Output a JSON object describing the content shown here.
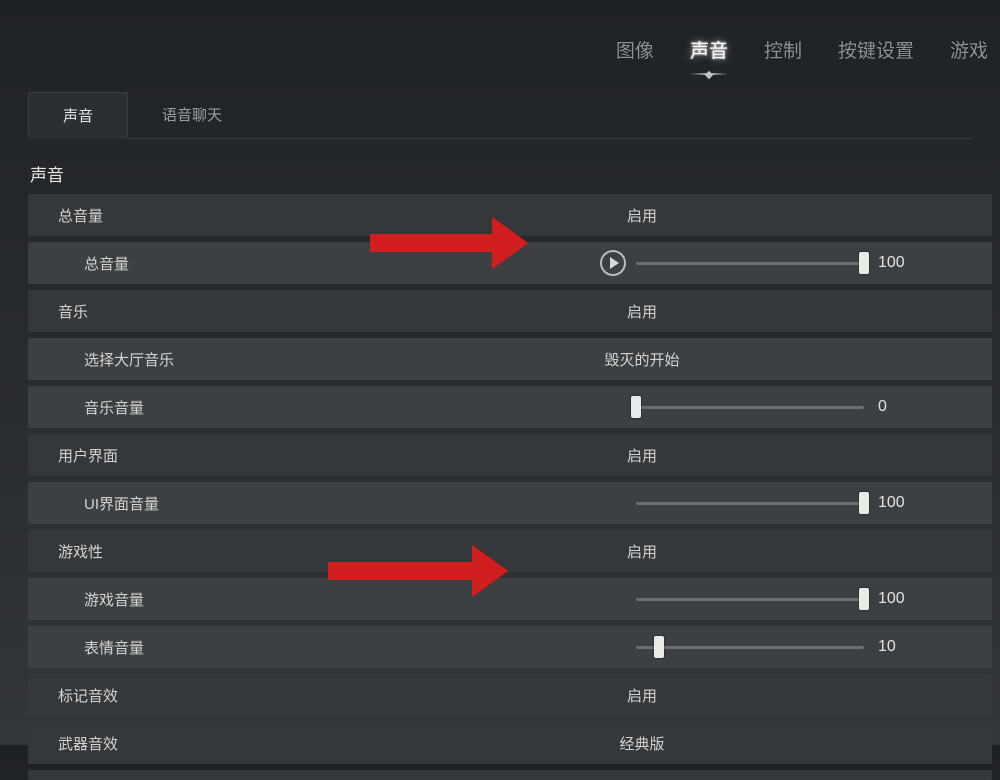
{
  "nav": {
    "image": "图像",
    "sound": "声音",
    "control": "控制",
    "keybind": "按键设置",
    "game": "游戏"
  },
  "subtabs": {
    "sound": "声音",
    "voice_chat": "语音聊天"
  },
  "section": {
    "title": "声音"
  },
  "labels": {
    "master": "总音量",
    "master_vol": "总音量",
    "music": "音乐",
    "lobby_music": "选择大厅音乐",
    "music_vol": "音乐音量",
    "ui": "用户界面",
    "ui_vol": "UI界面音量",
    "gameplay": "游戏性",
    "game_vol": "游戏音量",
    "emote_vol": "表情音量",
    "ping_sfx": "标记音效",
    "weapon_sfx": "武器音效"
  },
  "values": {
    "enabled": "启用",
    "lobby_music_val": "毁灭的开始",
    "master_vol": 100,
    "music_vol": 0,
    "ui_vol": 100,
    "game_vol": 100,
    "emote_vol": 10,
    "weapon_style": "经典版"
  }
}
